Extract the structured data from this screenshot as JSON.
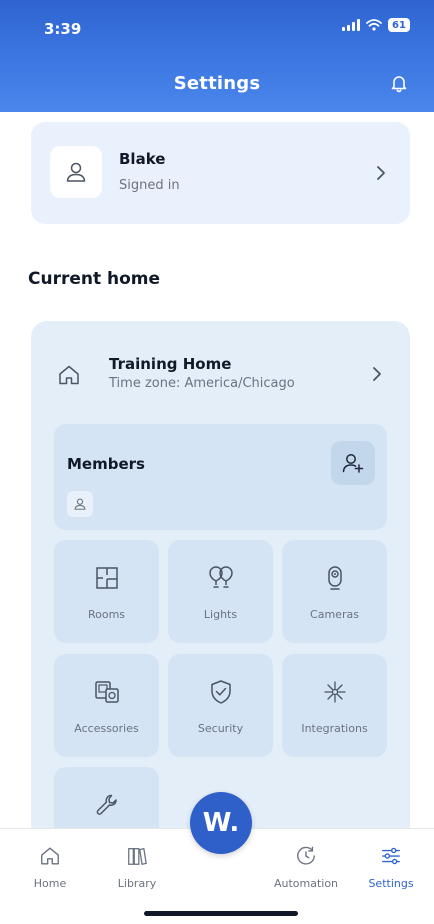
{
  "status_bar": {
    "time": "3:39",
    "battery": "61"
  },
  "header": {
    "title": "Settings",
    "icon": "bell-icon"
  },
  "profile": {
    "name": "Blake",
    "status": "Signed in"
  },
  "current_home": {
    "section_title": "Current home",
    "home_name": "Training Home",
    "timezone": "Time zone: America/Chicago",
    "members": {
      "title": "Members"
    },
    "tiles": [
      {
        "label": "Rooms",
        "icon": "floorplan-icon"
      },
      {
        "label": "Lights",
        "icon": "bulbs-icon"
      },
      {
        "label": "Cameras",
        "icon": "camera-icon"
      },
      {
        "label": "Accessories",
        "icon": "devices-icon"
      },
      {
        "label": "Security",
        "icon": "shield-icon"
      },
      {
        "label": "Integrations",
        "icon": "sparkle-icon"
      },
      {
        "label": "",
        "icon": "wrench-icon"
      }
    ]
  },
  "tabbar": {
    "tabs": [
      {
        "label": "Home",
        "icon": "home-icon"
      },
      {
        "label": "Library",
        "icon": "library-icon"
      },
      {
        "label": "Automation",
        "icon": "clock-icon"
      },
      {
        "label": "Settings",
        "icon": "sliders-icon",
        "active": true
      }
    ],
    "center_button": "W."
  },
  "colors": {
    "header_blue": "#2f64d0",
    "card_bg": "#e4eef9",
    "tile_bg": "#d4e4f5",
    "accent": "#2f5fc8"
  }
}
